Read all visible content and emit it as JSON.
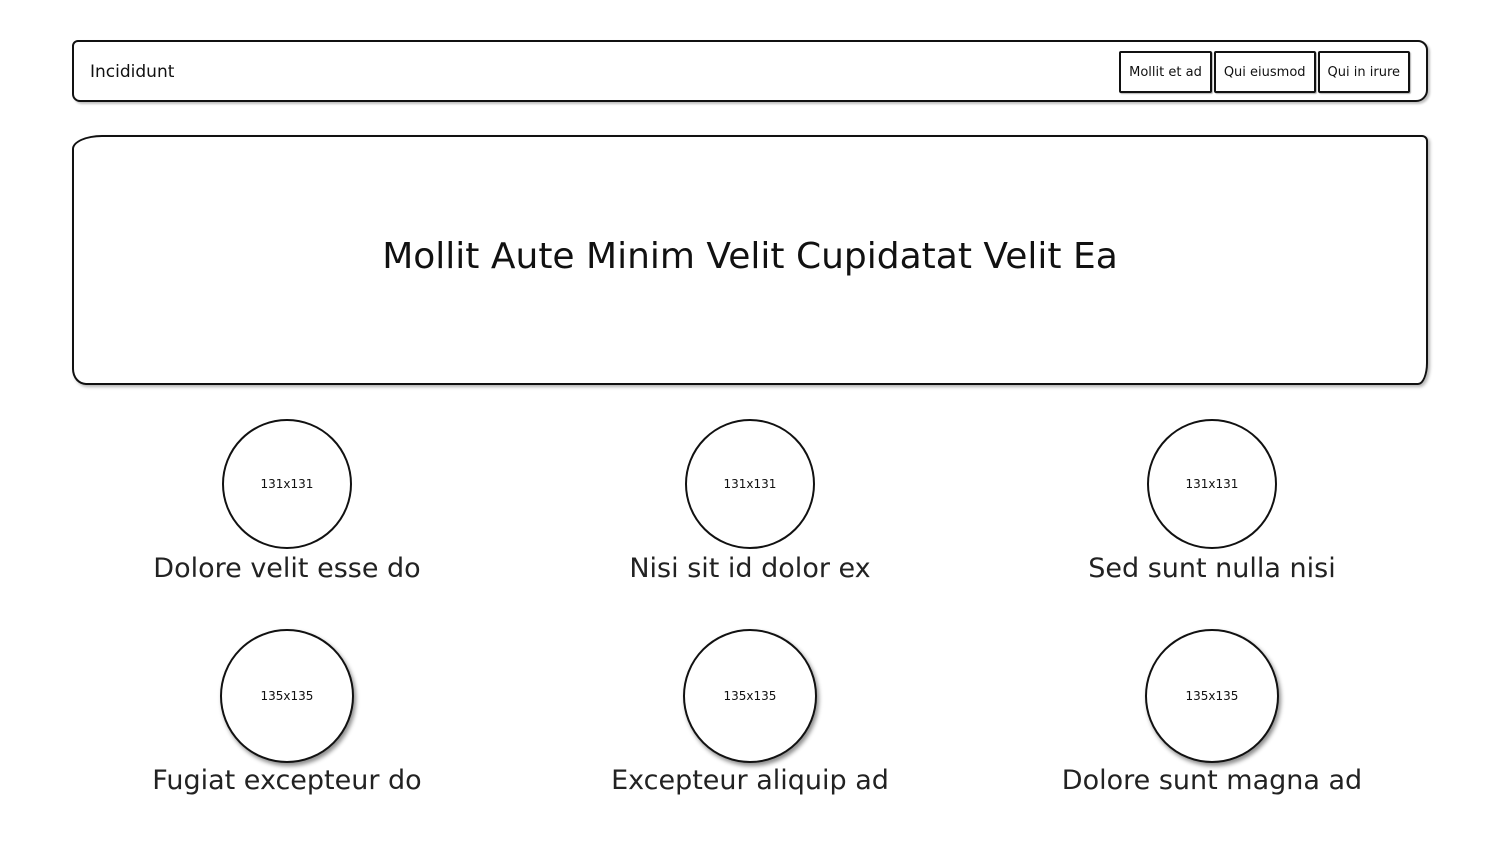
{
  "header": {
    "brand": "Incididunt",
    "nav": [
      "Mollit et ad",
      "Qui eiusmod",
      "Qui in irure"
    ]
  },
  "hero": {
    "title": "Mollit Aute Minim Velit Cupidatat Velit Ea"
  },
  "features": [
    {
      "image_label": "131x131",
      "caption": "Dolore velit esse do"
    },
    {
      "image_label": "131x131",
      "caption": "Nisi sit id dolor ex"
    },
    {
      "image_label": "131x131",
      "caption": "Sed sunt nulla nisi"
    },
    {
      "image_label": "135x135",
      "caption": "Fugiat excepteur do"
    },
    {
      "image_label": "135x135",
      "caption": "Excepteur aliquip ad"
    },
    {
      "image_label": "135x135",
      "caption": "Dolore sunt magna ad"
    }
  ]
}
